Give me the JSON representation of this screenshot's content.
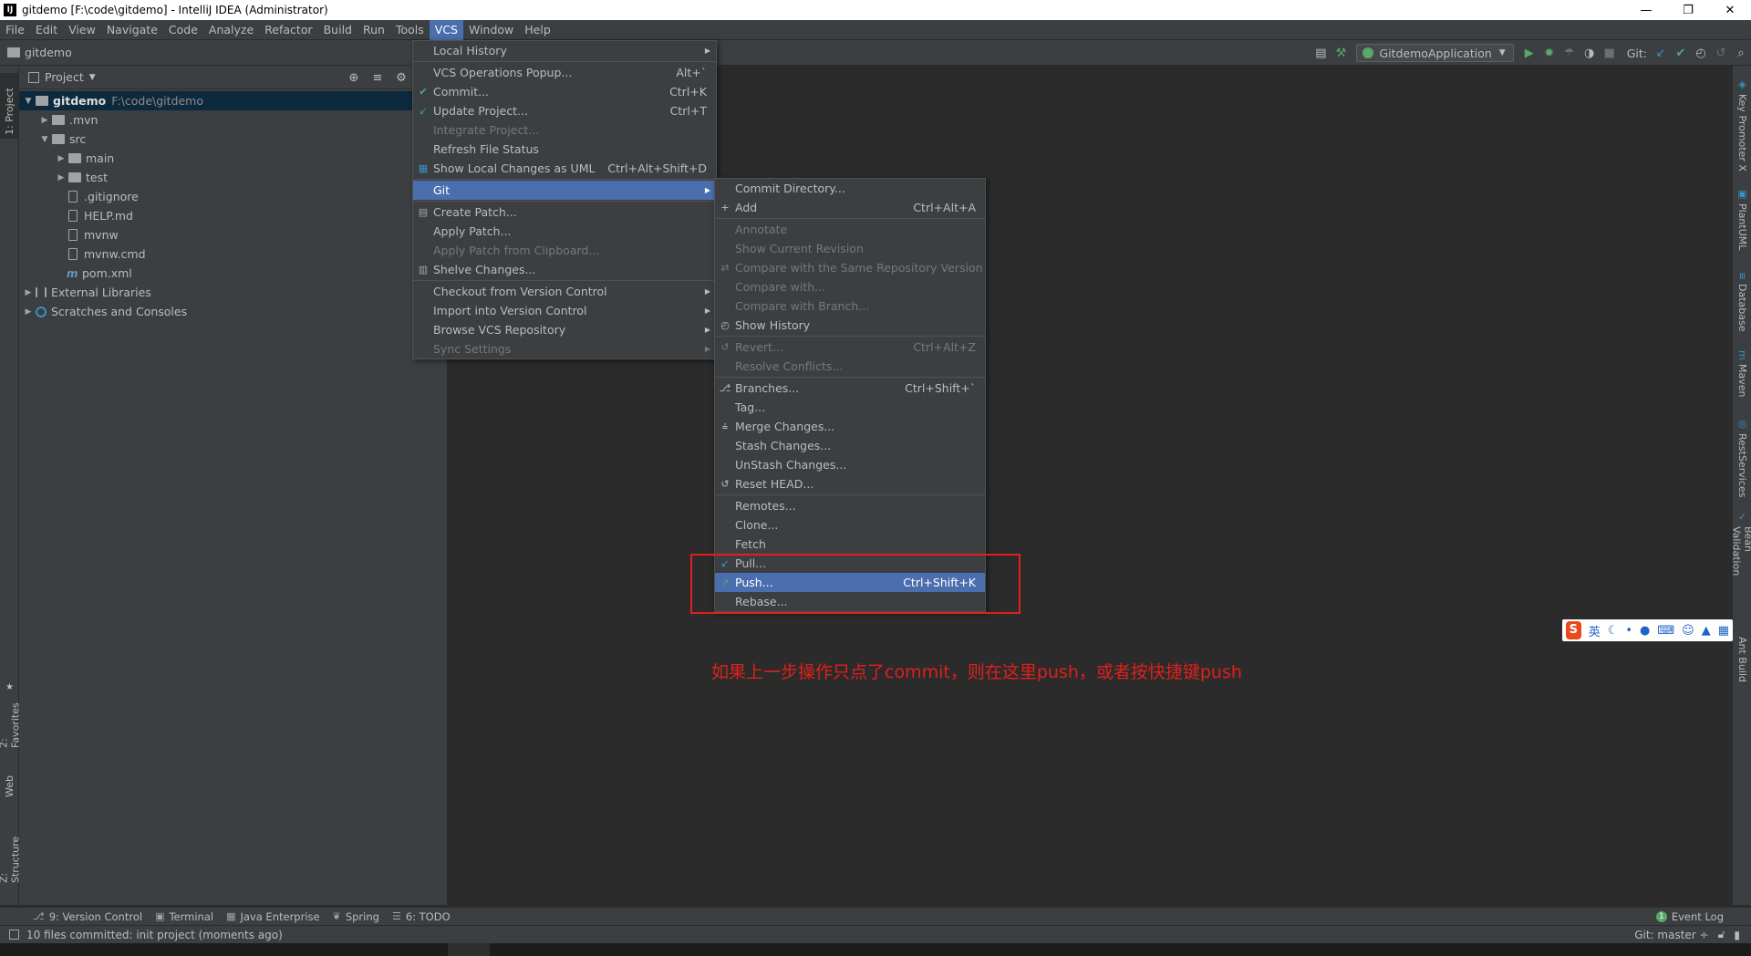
{
  "window": {
    "title": "gitdemo [F:\\code\\gitdemo] - IntelliJ IDEA (Administrator)",
    "app_icon": "IJ"
  },
  "menubar": [
    "File",
    "Edit",
    "View",
    "Navigate",
    "Code",
    "Analyze",
    "Refactor",
    "Build",
    "Run",
    "Tools",
    "VCS",
    "Window",
    "Help"
  ],
  "navbar": {
    "project": "gitdemo",
    "run_config": "GitdemoApplication",
    "git_label": "Git:"
  },
  "left_tabs": {
    "project": "1: Project",
    "favorites": "2: Favorites",
    "web": "Web",
    "structure": "Z: Structure"
  },
  "right_tabs": {
    "key_promoter": "Key Promoter X",
    "plantuml": "PlantUML",
    "database": "Database",
    "maven": "Maven",
    "rest": "RestServices",
    "bean": "Bean Validation",
    "ant": "Ant Build"
  },
  "project_panel": {
    "title": "Project",
    "tree": [
      {
        "name": "gitdemo",
        "path": "F:\\code\\gitdemo"
      },
      {
        "name": ".mvn"
      },
      {
        "name": "src"
      },
      {
        "name": "main"
      },
      {
        "name": "test"
      },
      {
        "name": ".gitignore"
      },
      {
        "name": "HELP.md"
      },
      {
        "name": "mvnw"
      },
      {
        "name": "mvnw.cmd"
      },
      {
        "name": "pom.xml"
      },
      {
        "name": "External Libraries"
      },
      {
        "name": "Scratches and Consoles"
      }
    ]
  },
  "vcs_menu": [
    {
      "label": "Local History"
    },
    {
      "label": "VCS Operations Popup...",
      "shortcut": "Alt+`"
    },
    {
      "label": "Commit...",
      "shortcut": "Ctrl+K"
    },
    {
      "label": "Update Project...",
      "shortcut": "Ctrl+T"
    },
    {
      "label": "Integrate Project..."
    },
    {
      "label": "Refresh File Status"
    },
    {
      "label": "Show Local Changes as UML",
      "shortcut": "Ctrl+Alt+Shift+D"
    },
    {
      "label": "Git"
    },
    {
      "label": "Create Patch..."
    },
    {
      "label": "Apply Patch..."
    },
    {
      "label": "Apply Patch from Clipboard..."
    },
    {
      "label": "Shelve Changes..."
    },
    {
      "label": "Checkout from Version Control"
    },
    {
      "label": "Import into Version Control"
    },
    {
      "label": "Browse VCS Repository"
    },
    {
      "label": "Sync Settings"
    }
  ],
  "git_menu": [
    {
      "label": "Commit Directory..."
    },
    {
      "label": "Add",
      "shortcut": "Ctrl+Alt+A"
    },
    {
      "label": "Annotate"
    },
    {
      "label": "Show Current Revision"
    },
    {
      "label": "Compare with the Same Repository Version"
    },
    {
      "label": "Compare with..."
    },
    {
      "label": "Compare with Branch..."
    },
    {
      "label": "Show History"
    },
    {
      "label": "Revert...",
      "shortcut": "Ctrl+Alt+Z"
    },
    {
      "label": "Resolve Conflicts..."
    },
    {
      "label": "Branches...",
      "shortcut": "Ctrl+Shift+`"
    },
    {
      "label": "Tag..."
    },
    {
      "label": "Merge Changes..."
    },
    {
      "label": "Stash Changes..."
    },
    {
      "label": "UnStash Changes..."
    },
    {
      "label": "Reset HEAD..."
    },
    {
      "label": "Remotes..."
    },
    {
      "label": "Clone..."
    },
    {
      "label": "Fetch"
    },
    {
      "label": "Pull..."
    },
    {
      "label": "Push...",
      "shortcut": "Ctrl+Shift+K"
    },
    {
      "label": "Rebase..."
    }
  ],
  "annotation": "如果上一步操作只点了commit，则在这里push，或者按快捷键push",
  "ime": {
    "logo": "S",
    "lang": "英"
  },
  "bottom_tools": {
    "version_control": "9: Version Control",
    "terminal": "Terminal",
    "java_enterprise": "Java Enterprise",
    "spring": "Spring",
    "todo": "6: TODO",
    "event_log": "Event Log",
    "event_count": "1"
  },
  "status": {
    "message": "10 files committed: init project (moments ago)",
    "branch": "Git: master ÷"
  },
  "colors": {
    "accent": "#4b6eaf",
    "annotation": "#e0201a",
    "run_green": "#59a869"
  }
}
